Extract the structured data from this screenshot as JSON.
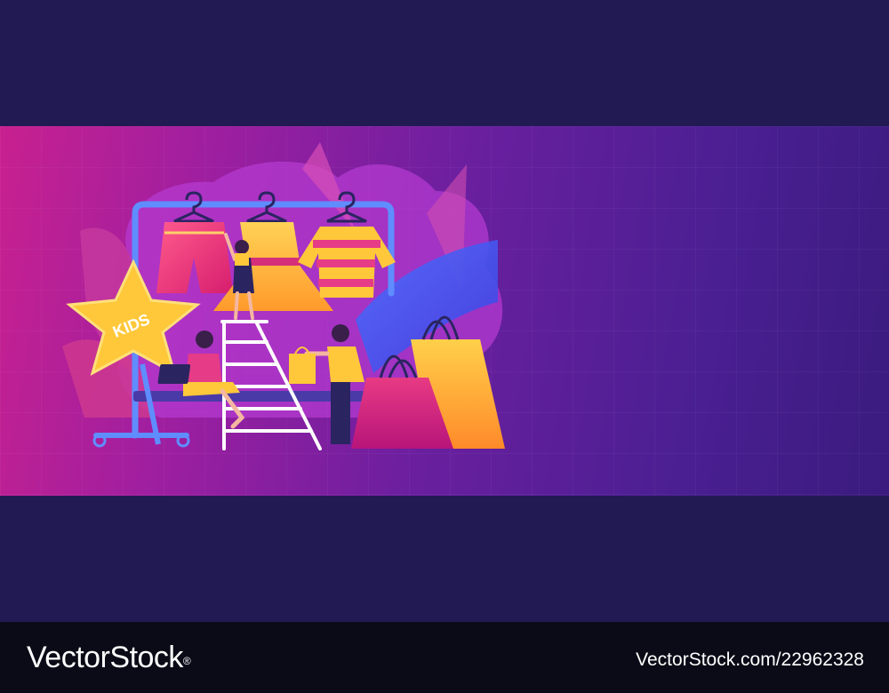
{
  "illustration": {
    "star_label": "KIDS"
  },
  "footer": {
    "brand": "VectorStock",
    "brand_mark": "®",
    "image_id": "VectorStock.com/22962328"
  },
  "colors": {
    "background": "#221a52",
    "hero_gradient_start": "#c8208f",
    "hero_gradient_end": "#3a1b7e",
    "accent_yellow": "#ffc83a",
    "footer": "#0b0b17"
  }
}
